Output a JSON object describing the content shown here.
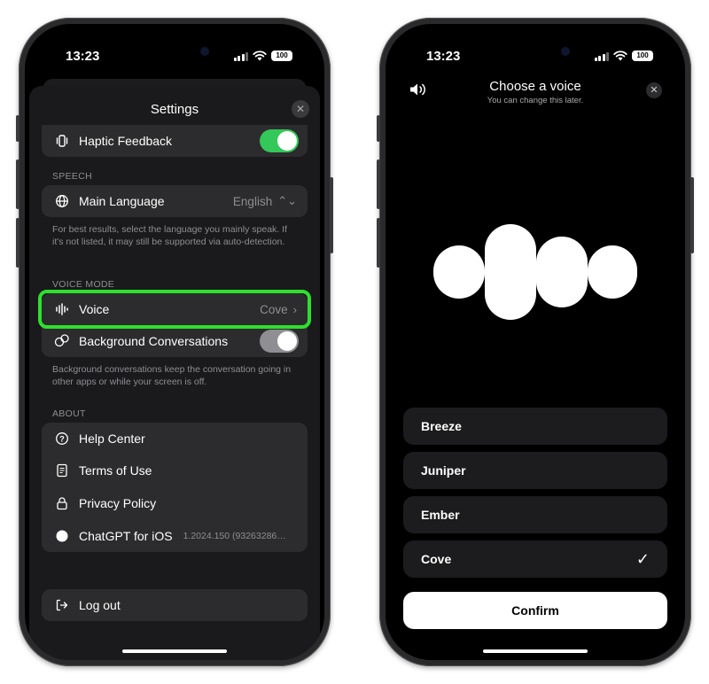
{
  "status_bar": {
    "time": "13:23",
    "battery": "100"
  },
  "settings": {
    "title": "Settings",
    "close_icon": "close-icon",
    "haptic": {
      "label": "Haptic Feedback",
      "enabled": true
    },
    "speech_section": "SPEECH",
    "main_language": {
      "label": "Main Language",
      "value": "English"
    },
    "speech_note": "For best results, select the language you mainly speak. If it's not listed, it may still be supported via auto-detection.",
    "voice_section": "VOICE MODE",
    "voice": {
      "label": "Voice",
      "value": "Cove"
    },
    "background": {
      "label": "Background Conversations",
      "enabled": false
    },
    "background_note": "Background conversations keep the conversation going in other apps or while your screen is off.",
    "about_section": "ABOUT",
    "about_items": [
      {
        "label": "Help Center",
        "icon": "question-icon"
      },
      {
        "label": "Terms of Use",
        "icon": "document-icon"
      },
      {
        "label": "Privacy Policy",
        "icon": "lock-icon"
      },
      {
        "label": "ChatGPT for iOS",
        "icon": "openai-logo-icon",
        "value": "1.2024.150 (93263286…"
      }
    ],
    "logout": {
      "label": "Log out",
      "icon": "logout-icon"
    },
    "highlight_color": "#2ee02e",
    "toggle_on_color": "#34c759"
  },
  "voice_picker": {
    "title": "Choose a voice",
    "subtitle": "You can change this later.",
    "options": [
      "Breeze",
      "Juniper",
      "Ember",
      "Cove"
    ],
    "selected": "Cove",
    "confirm_label": "Confirm"
  }
}
